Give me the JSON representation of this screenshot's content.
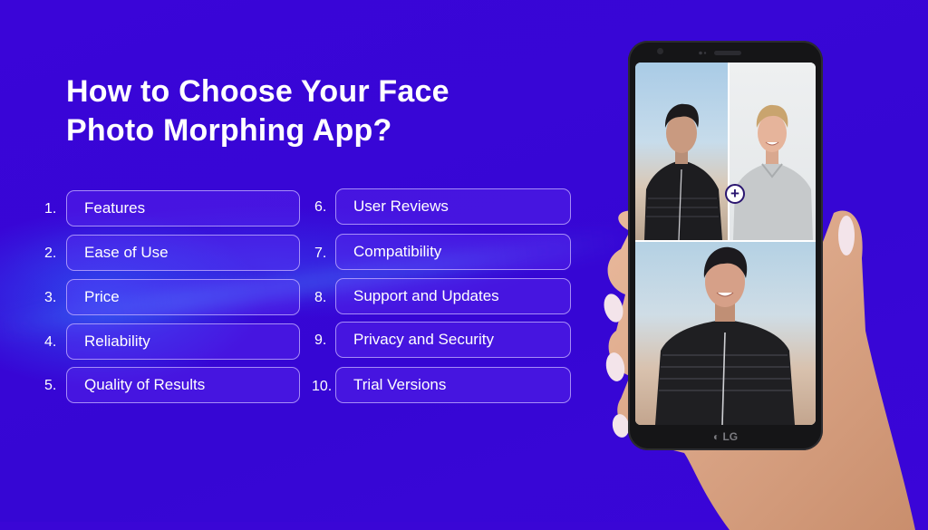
{
  "title": {
    "line1": "How to Choose Your Face",
    "line2": "Photo Morphing App?"
  },
  "left_items": [
    {
      "number": "1.",
      "label": "Features"
    },
    {
      "number": "2.",
      "label": "Ease of Use"
    },
    {
      "number": "3.",
      "label": "Price"
    },
    {
      "number": "4.",
      "label": "Reliability"
    },
    {
      "number": "5.",
      "label": "Quality of Results"
    }
  ],
  "right_items": [
    {
      "number": "6.",
      "label": "User Reviews"
    },
    {
      "number": "7.",
      "label": "Compatibility"
    },
    {
      "number": "8.",
      "label": "Support and Updates"
    },
    {
      "number": "9.",
      "label": "Privacy and Security"
    },
    {
      "number": "10.",
      "label": "Trial Versions"
    }
  ],
  "phone": {
    "brand": "LG",
    "plus_symbol": "+",
    "photos": [
      "face-photo-1",
      "face-photo-2",
      "morphed-face-photo"
    ]
  },
  "colors": {
    "background": "#3a06d6",
    "item_border": "#c8b4ff",
    "text": "#ffffff"
  }
}
